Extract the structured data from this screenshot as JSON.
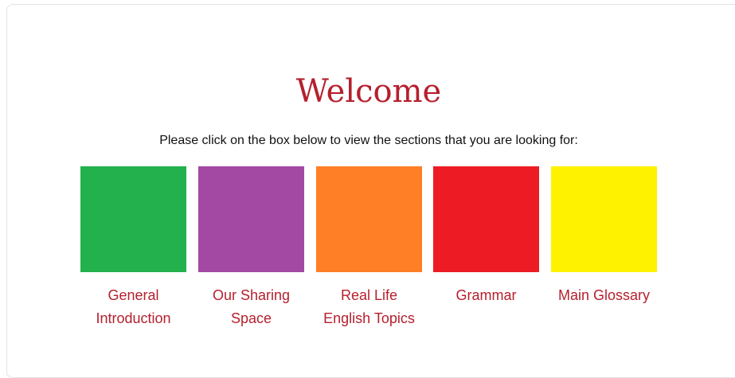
{
  "welcome": {
    "title": "Welcome",
    "instruction": "Please click on the box below to view the sections that you are looking for:"
  },
  "sections": [
    {
      "label": "General\nIntroduction",
      "color": "#22b14c"
    },
    {
      "label": "Our Sharing\nSpace",
      "color": "#a349a4"
    },
    {
      "label": "Real Life\nEnglish Topics",
      "color": "#ff7f27"
    },
    {
      "label": "Grammar",
      "color": "#ed1c24"
    },
    {
      "label": "Main Glossary",
      "color": "#fff200"
    }
  ],
  "colors": {
    "accent": "#b5202e",
    "text": "#111111",
    "border": "#e3e3e3"
  }
}
